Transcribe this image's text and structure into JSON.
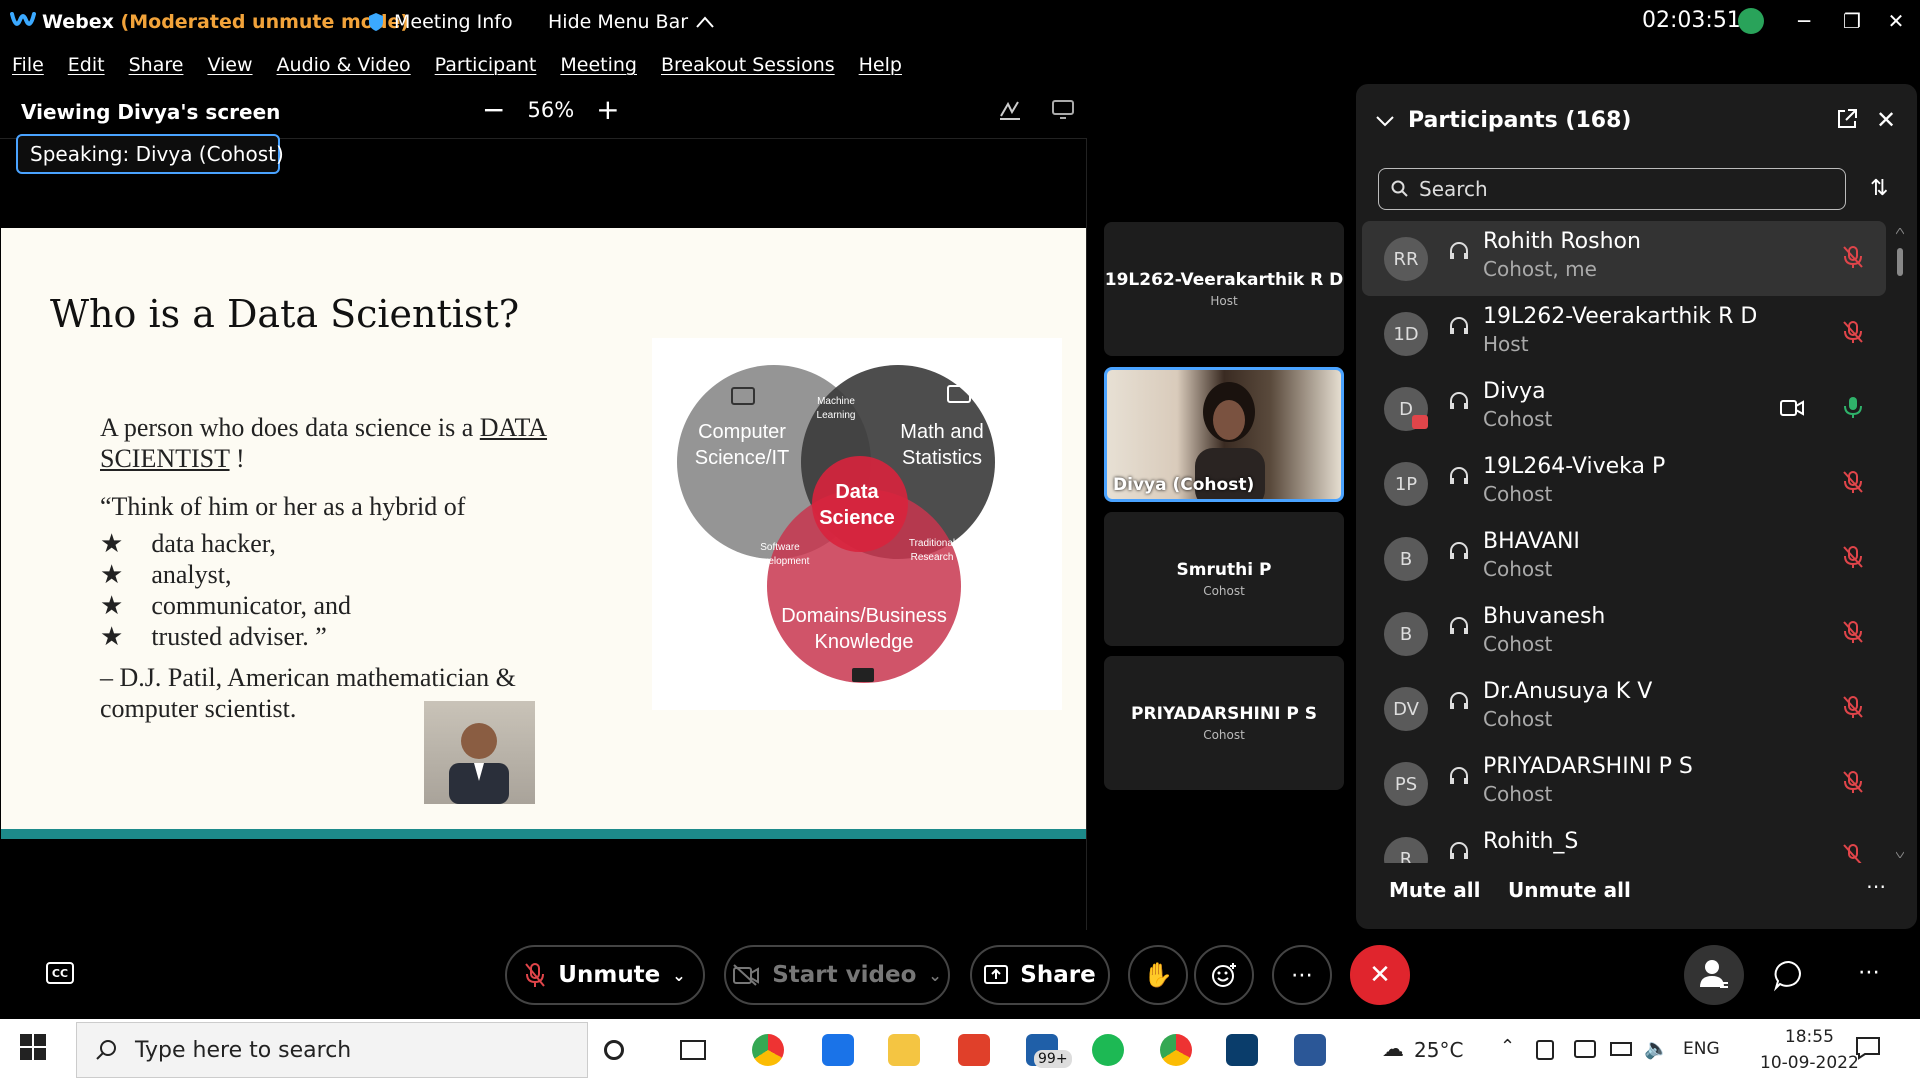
{
  "titlebar": {
    "app_name": "Webex",
    "mode": "(Moderated unmute mode)",
    "meeting_info": "Meeting Info",
    "hide_menu": "Hide Menu Bar",
    "clock": "02:03:51"
  },
  "menu": [
    "File",
    "Edit",
    "Share",
    "View",
    "Audio & Video",
    "Participant",
    "Meeting",
    "Breakout Sessions",
    "Help"
  ],
  "viewer": {
    "viewing": "Viewing Divya's screen",
    "zoom_out": "−",
    "zoom": "56%",
    "zoom_in": "+",
    "speaking_label": "Speaking:",
    "speaking_name": "Divya (Cohost)"
  },
  "slide": {
    "title": "Who is a Data Scientist?",
    "para_prefix": "A person who does data science is a ",
    "para_link": "DATA SCIENTIST",
    "para_suffix": " !",
    "quote": "“Think of him or her as a hybrid of",
    "bullets": [
      "data hacker,",
      "analyst,",
      "communicator, and",
      "trusted adviser. ”"
    ],
    "attribution": "– D.J. Patil, American mathematician & computer scientist.",
    "venn": {
      "cs": [
        "Computer",
        "Science/IT"
      ],
      "math": [
        "Math and",
        "Statistics"
      ],
      "ml": [
        "Machine",
        "Learning"
      ],
      "ds": [
        "Data",
        "Science"
      ],
      "sw": [
        "Software",
        "Development"
      ],
      "tr": [
        "Traditional",
        "Research"
      ],
      "dom": [
        "Domains/Business",
        "Knowledge"
      ]
    }
  },
  "thumbnails": [
    {
      "name": "19L262-Veerakarthik R D",
      "role": "Host"
    },
    {
      "name": "Divya (Cohost)",
      "role": ""
    },
    {
      "name": "Smruthi P",
      "role": "Cohost"
    },
    {
      "name": "PRIYADARSHINI P S",
      "role": "Cohost"
    }
  ],
  "panel": {
    "title": "Participants (168)",
    "search_placeholder": "Search",
    "mute_all": "Mute all",
    "unmute_all": "Unmute all",
    "participants": [
      {
        "initials": "RR",
        "name": "Rohith Roshon",
        "role": "Cohost, me",
        "mic": "muted"
      },
      {
        "initials": "1D",
        "name": "19L262-Veerakarthik R D",
        "role": "Host",
        "mic": "muted"
      },
      {
        "initials": "D",
        "name": "Divya",
        "role": "Cohost",
        "mic": "on"
      },
      {
        "initials": "1P",
        "name": "19L264-Viveka P",
        "role": "Cohost",
        "mic": "muted"
      },
      {
        "initials": "B",
        "name": "BHAVANI",
        "role": "Cohost",
        "mic": "muted"
      },
      {
        "initials": "B",
        "name": "Bhuvanesh",
        "role": "Cohost",
        "mic": "muted"
      },
      {
        "initials": "DV",
        "name": "Dr.Anusuya K V",
        "role": "Cohost",
        "mic": "muted"
      },
      {
        "initials": "PS",
        "name": "PRIYADARSHINI P S",
        "role": "Cohost",
        "mic": "muted"
      },
      {
        "initials": "R",
        "name": "Rohith_S",
        "role": "",
        "mic": "muted"
      }
    ]
  },
  "toolbar": {
    "unmute": "Unmute",
    "start_video": "Start video",
    "share": "Share"
  },
  "taskbar": {
    "search_placeholder": "Type here to search",
    "badge": "99+",
    "temperature": "25°C",
    "lang": "ENG",
    "time": "18:55",
    "date": "10-09-2022"
  },
  "colors": {
    "accent": "#4aa3ff",
    "end_call": "#e0252d",
    "mode": "#f2a33a",
    "muted": "#e0454a",
    "mic_on": "#2fb26a"
  }
}
